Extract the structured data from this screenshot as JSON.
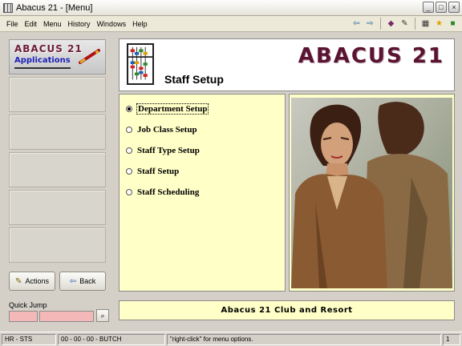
{
  "window": {
    "title": "Abacus 21 - [Menu]",
    "controls": [
      "_",
      "□",
      "×"
    ]
  },
  "menubar": {
    "items": [
      "File",
      "Edit",
      "Menu",
      "History",
      "Windows",
      "Help"
    ]
  },
  "toolbar": {
    "icons": [
      "arrow-left-icon",
      "arrow-right-icon",
      "book-icon",
      "pen-icon",
      "calculator-icon",
      "running-man-icon",
      "exit-door-icon"
    ]
  },
  "sidebar": {
    "logo_title": "ABACUS 21",
    "logo_subtitle": "Applications",
    "actions_label": "Actions",
    "back_label": "Back"
  },
  "header": {
    "title": "Staff Setup",
    "brand": "ABACUS 21"
  },
  "options": [
    {
      "label": "Department Setup",
      "selected": true
    },
    {
      "label": "Job Class Setup",
      "selected": false
    },
    {
      "label": "Staff Type Setup",
      "selected": false
    },
    {
      "label": "Staff Setup",
      "selected": false
    },
    {
      "label": "Staff Scheduling",
      "selected": false
    }
  ],
  "quick_jump": {
    "label": "Quick Jump",
    "value1": "",
    "value2": ""
  },
  "club_name": "Abacus 21 Club and Resort",
  "statusbar": {
    "module": "HR - STS",
    "user": "00 - 00 - 00 - BUTCH",
    "hint": "\"right-click\" for menu options.",
    "page": "1"
  },
  "colors": {
    "panel_yellow": "#ffffc8",
    "brand_maroon": "#5a1330",
    "quick_jump_pink": "#f5b8b8"
  }
}
